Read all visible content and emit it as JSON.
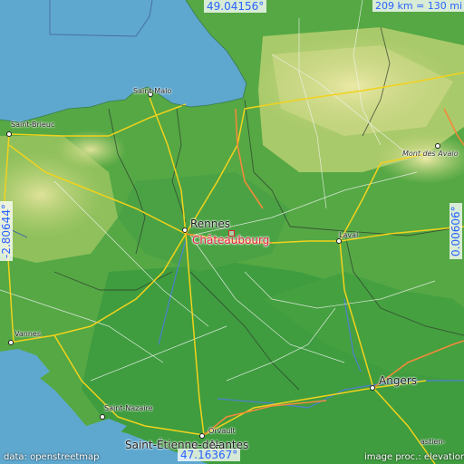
{
  "map": {
    "coords": {
      "top": "49.04156°",
      "bottom": "47.16367°",
      "left": "-2.80644°",
      "right": "0.00606°"
    },
    "scale": "209 km = 130 mi",
    "target": "Châteaubourg",
    "cities": [
      "Saint-Malo",
      "Saint-Brieuc",
      "Rennes",
      "Laval",
      "Vannes",
      "Angers",
      "Saint-Nazaire",
      "Orvault",
      "Nantes",
      "Saint-Étienne-de-"
    ],
    "peak": "Mont des Avaloirs",
    "peak_short": "Mont des Avalo",
    "fragment": "astien-",
    "attribution_left": "data: openstreetmap",
    "attribution_right": "image proc.: elevation.city",
    "colors": {
      "sea": "#5ea8cf",
      "lowland": "#3f9d3f",
      "midland": "#6ab44a",
      "upland": "#c2d47e",
      "road": "#f2d21c",
      "target": "#e0203a",
      "coords_text": "#2a63ff"
    }
  }
}
